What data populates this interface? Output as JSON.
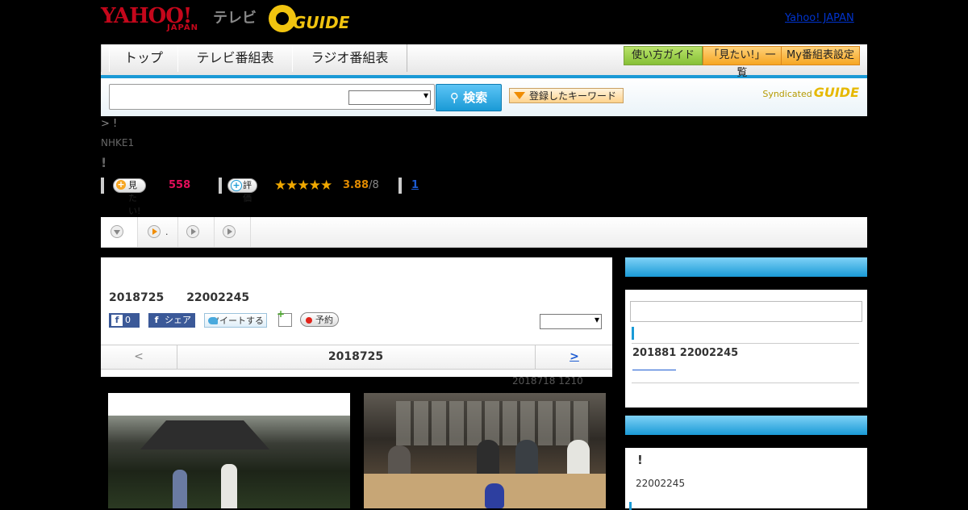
{
  "header": {
    "logo_yahoo": "YAHOO!",
    "logo_japan": "JAPAN",
    "logo_tv": "テレビ",
    "logo_gguide": "GUIDE",
    "yahoo_japan_link": "Yahoo! JAPAN"
  },
  "nav": {
    "tabs": [
      {
        "label": "トップ"
      },
      {
        "label": "テレビ番組表"
      },
      {
        "label": "ラジオ番組表"
      }
    ],
    "buttons": [
      {
        "label": "使い方ガイド"
      },
      {
        "label": "「見たい!」一覧"
      },
      {
        "label": "My番組表設定"
      }
    ]
  },
  "search": {
    "input_value": "",
    "button_label": "検索",
    "keyword_button": "登録したキーワード",
    "syndicated_label": "Syndicated",
    "syndicated_logo": "GUIDE"
  },
  "program": {
    "breadcrumb": "> !",
    "station": "NHKE1",
    "title": "!",
    "mitai_label": "見たい!",
    "mitai_count": "558",
    "hyoka_label": "評価",
    "stars": "★★★★★",
    "star_rating": 3.88,
    "score": "3.88",
    "score_of": "/8",
    "review_link": "1"
  },
  "subtabs": {
    "second_label": "."
  },
  "main": {
    "date_time": "2018725　　22002245",
    "fb_count": "0",
    "fb_icon": "f",
    "share_label": "シェア",
    "tweet_label": "ツイートする",
    "reserve_label": "予約",
    "pager_prev": "<",
    "pager_mid": "2018725",
    "pager_next": ">",
    "updated": "2018718  1210"
  },
  "right": {
    "next_air": "201881  22002245",
    "bang": "!",
    "time": "22002245"
  },
  "colors": {
    "accent_blue": "#1a9ad6",
    "yahoo_red": "#c4071b",
    "gguide_yellow": "#f1c40f",
    "mitai_pink": "#e30e5a"
  }
}
